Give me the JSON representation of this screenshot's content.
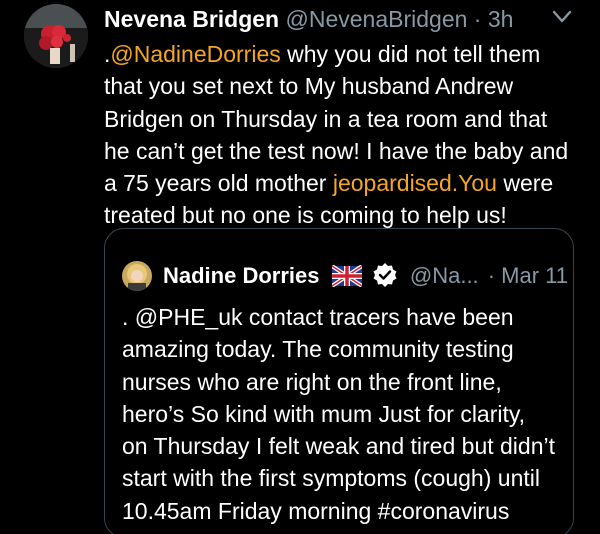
{
  "tweet": {
    "author_name": "Nevena Bridgen",
    "author_handle": "@NevenaBridgen",
    "separator": "·",
    "time": "3h",
    "body_lines": [
      {
        "parts": [
          {
            "text": ".",
            "link": false
          },
          {
            "text": "@NadineDorries",
            "link": true
          },
          {
            "text": " why you did not tell them",
            "link": false
          }
        ]
      },
      {
        "parts": [
          {
            "text": "that you set next to My husband Andrew",
            "link": false
          }
        ]
      },
      {
        "parts": [
          {
            "text": "Bridgen on Thursday in a tea room  and that",
            "link": false
          }
        ]
      },
      {
        "parts": [
          {
            "text": "he can’t get the test now! I have the baby and",
            "link": false
          }
        ]
      },
      {
        "parts": [
          {
            "text": "a 75 years old mother ",
            "link": false
          },
          {
            "text": "jeopardised.You",
            "link": true
          },
          {
            "text": " were",
            "link": false
          }
        ]
      },
      {
        "parts": [
          {
            "text": "treated but no one is coming to help us!",
            "link": false
          }
        ]
      }
    ]
  },
  "quoted_tweet": {
    "author_name": "Nadine Dorries",
    "author_handle": "@Na...",
    "date": "· Mar 11",
    "body_lines": [
      ". @PHE_uk contact tracers have been",
      "amazing today. The community testing",
      "nurses who are right on the front line,",
      "hero’s So kind with mum Just for clarity,",
      "on Thursday I felt weak and tired but didn’t",
      "start with the first symptoms (cough) until",
      "10.45am Friday morning #coronavirus"
    ]
  },
  "icons": {
    "menu": "chevron-down-icon",
    "flag": "uk-flag-icon",
    "verified": "verified-badge-icon"
  },
  "colors": {
    "background": "#000000",
    "text": "#ffffff",
    "secondary": "#8899a6",
    "link": "#f5a623",
    "border": "#38444d",
    "verified_badge": "#ffffff"
  }
}
